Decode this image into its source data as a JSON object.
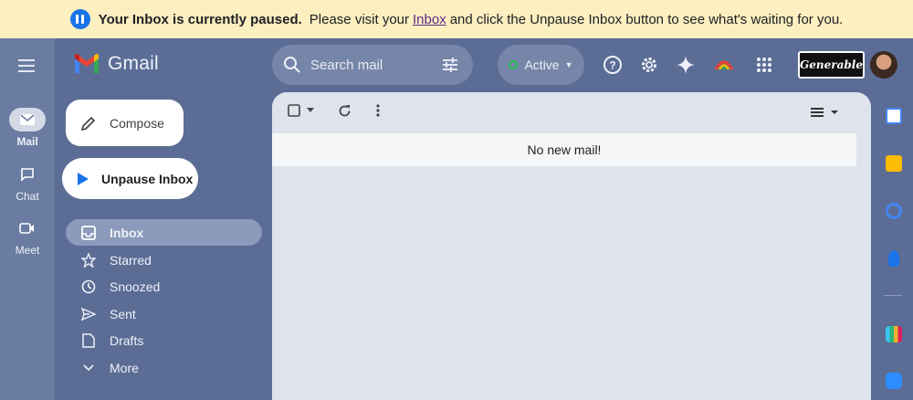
{
  "banner": {
    "bold_text": "Your Inbox is currently paused.",
    "text_before": "Please visit your",
    "link": "Inbox",
    "text_after": "and click the Unpause Inbox button to see what's waiting for you."
  },
  "rail": {
    "items": [
      {
        "label": "Mail",
        "icon": "mail-icon"
      },
      {
        "label": "Chat",
        "icon": "chat-icon"
      },
      {
        "label": "Meet",
        "icon": "video-icon"
      }
    ]
  },
  "header": {
    "app_name": "Gmail",
    "search_placeholder": "Search mail",
    "status": "Active",
    "brand": "Generable"
  },
  "nav": {
    "compose": "Compose",
    "unpause": "Unpause Inbox",
    "items": [
      {
        "label": "Inbox",
        "icon": "inbox-icon",
        "active": true
      },
      {
        "label": "Starred",
        "icon": "star-icon"
      },
      {
        "label": "Snoozed",
        "icon": "clock-icon"
      },
      {
        "label": "Sent",
        "icon": "send-icon"
      },
      {
        "label": "Drafts",
        "icon": "draft-icon"
      },
      {
        "label": "More",
        "icon": "chevron-down-icon"
      }
    ]
  },
  "main": {
    "empty_message": "No new mail!"
  },
  "colors": {
    "banner_bg": "#fcefc0",
    "theme_bg": "#5b6d95",
    "active_nav": "#8c9abb",
    "status_green": "#2ec257"
  }
}
